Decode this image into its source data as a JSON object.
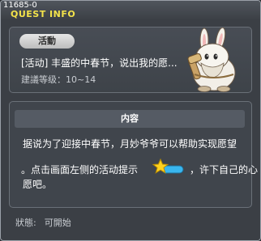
{
  "header": {
    "quest_id": "11685-0",
    "title": "QUEST INFO"
  },
  "quest": {
    "category_badge": "活動",
    "name": "[活动] 丰盛的中春节，说出我的愿...",
    "recommended_level": "建議等级：10~14"
  },
  "details": {
    "section_title": "内容",
    "line1": "据说为了迎接中春节，月妙爷爷可以帮助实现愿望",
    "line2_prefix": "。点击画面左侧的活动提示",
    "line2_suffix": "，许下自己的心",
    "line3": "愿吧。",
    "hint_icon": "star-event-icon"
  },
  "status": {
    "label": "狀態:",
    "value": "可開始"
  },
  "colors": {
    "title": "#f3e34a",
    "background": "#3b3f45",
    "hint_blue": "#39b6ef"
  }
}
